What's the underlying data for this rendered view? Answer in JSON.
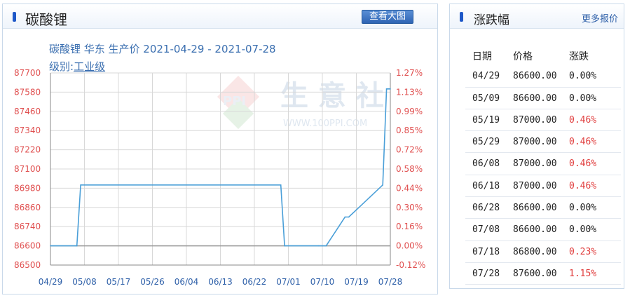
{
  "left_panel": {
    "title": "碳酸锂",
    "big_chart_button": "查看大图",
    "subtitle": "碳酸锂 华东 生产价 2021-04-29 - 2021-07-28",
    "grade_label": "级别:",
    "grade_value": "工业级",
    "watermark_text": "生 意 社",
    "watermark_url": "WWW.100PPI.COM"
  },
  "chart_data": {
    "type": "line",
    "title": "碳酸锂 华东 生产价 2021-04-29 - 2021-07-28",
    "xlabel": "",
    "ylabel": "",
    "left_ticks": [
      "87700",
      "87580",
      "87460",
      "87340",
      "87220",
      "87100",
      "86980",
      "86860",
      "86740",
      "86600",
      "86500"
    ],
    "right_ticks": [
      "1.27%",
      "1.13%",
      "0.99%",
      "0.85%",
      "0.72%",
      "0.58%",
      "0.44%",
      "0.30%",
      "0.16%",
      "0.00%",
      "-0.12%"
    ],
    "x_ticks": [
      "04/29",
      "05/08",
      "05/17",
      "05/26",
      "06/04",
      "06/13",
      "06/22",
      "07/01",
      "07/10",
      "07/19",
      "07/28"
    ],
    "ylim": [
      86500,
      87700
    ],
    "grid": true,
    "colors": {
      "line": "#4a9fd8",
      "left_tick": "#e05050",
      "left_tick_last": "#3aa03a",
      "right_tick": "#e05050",
      "right_tick_last": "#3aa03a",
      "grid": "#d8d8d8"
    },
    "series": [
      {
        "x": [
          "2021-04-29",
          "2021-05-06",
          "2021-05-07",
          "2021-06-29",
          "2021-06-30",
          "2021-07-09",
          "2021-07-10",
          "2021-07-11",
          "2021-07-16",
          "2021-07-17",
          "2021-07-26",
          "2021-07-27",
          "2021-07-28"
        ],
        "y": [
          86600,
          86600,
          87000,
          87000,
          86600,
          86600,
          86600,
          86600,
          86800,
          86800,
          87000,
          87600,
          87600
        ]
      }
    ]
  },
  "right_panel": {
    "title": "涨跌幅",
    "more_link": "更多报价",
    "headers": [
      "日期",
      "价格",
      "涨跌"
    ],
    "rows": [
      {
        "date": "04/29",
        "price": "86600.00",
        "change": "0.00%",
        "up": false
      },
      {
        "date": "05/09",
        "price": "86600.00",
        "change": "0.00%",
        "up": false
      },
      {
        "date": "05/19",
        "price": "87000.00",
        "change": "0.46%",
        "up": true
      },
      {
        "date": "05/29",
        "price": "87000.00",
        "change": "0.46%",
        "up": true
      },
      {
        "date": "06/08",
        "price": "87000.00",
        "change": "0.46%",
        "up": true
      },
      {
        "date": "06/18",
        "price": "87000.00",
        "change": "0.46%",
        "up": true
      },
      {
        "date": "06/28",
        "price": "86600.00",
        "change": "0.00%",
        "up": false
      },
      {
        "date": "07/08",
        "price": "86600.00",
        "change": "0.00%",
        "up": false
      },
      {
        "date": "07/18",
        "price": "86800.00",
        "change": "0.23%",
        "up": true
      },
      {
        "date": "07/28",
        "price": "87600.00",
        "change": "1.15%",
        "up": true
      }
    ]
  }
}
